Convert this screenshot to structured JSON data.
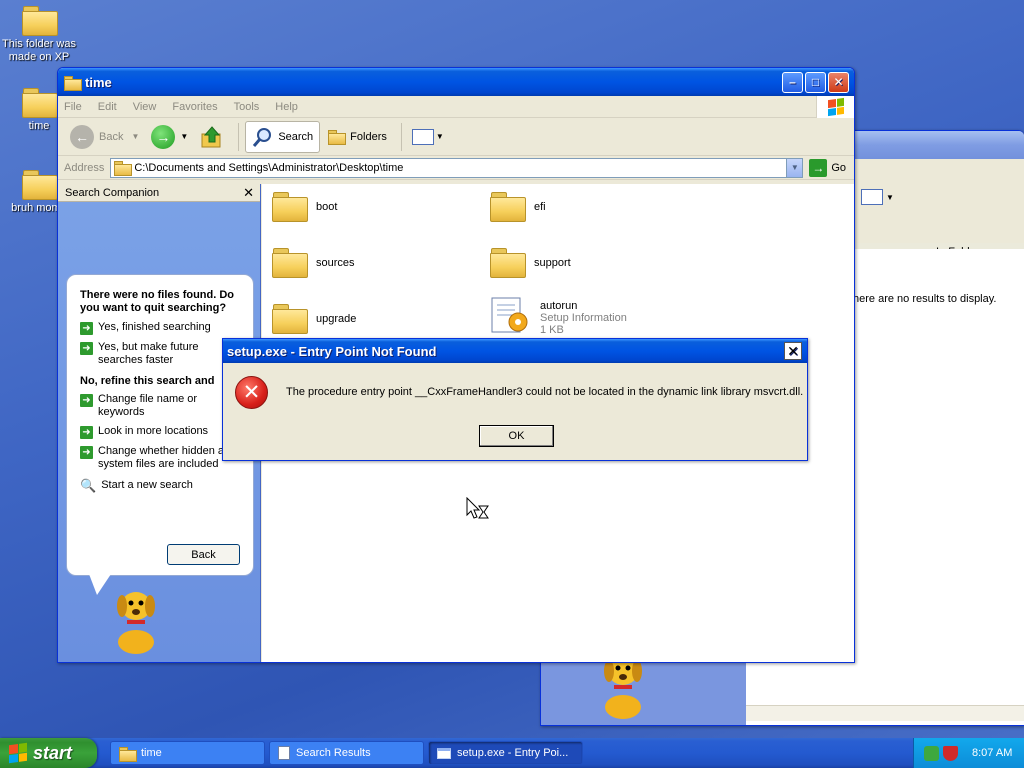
{
  "desktop": {
    "icons": [
      {
        "label": "This folder was made on XP"
      },
      {
        "label": "time"
      },
      {
        "label": "bruh mome"
      }
    ]
  },
  "background_window": {
    "column_header": "In Folder",
    "empty_message": "here are no results to display."
  },
  "explorer": {
    "title": "time",
    "menu": [
      "File",
      "Edit",
      "View",
      "Favorites",
      "Tools",
      "Help"
    ],
    "toolbar": {
      "back": "Back",
      "search": "Search",
      "folders": "Folders"
    },
    "address_label": "Address",
    "address_value": "C:\\Documents and Settings\\Administrator\\Desktop\\time",
    "go_label": "Go",
    "companion": {
      "header": "Search Companion",
      "heading": "There were no files found. Do you want to quit searching?",
      "options": [
        "Yes, finished searching",
        "Yes, but make future searches faster"
      ],
      "refine_heading": "No, refine this search and",
      "refine_options": [
        "Change file name or keywords",
        "Look in more locations",
        "Change whether hidden and system files are included"
      ],
      "new_search": "Start a new search",
      "back_button": "Back"
    },
    "files": [
      {
        "name": "boot"
      },
      {
        "name": "efi"
      },
      {
        "name": "sources"
      },
      {
        "name": "support"
      },
      {
        "name": "upgrade"
      },
      {
        "name": "autorun",
        "type": "Setup Information",
        "size": "1 KB"
      }
    ]
  },
  "dialog": {
    "title": "setup.exe - Entry Point Not Found",
    "message": "The procedure entry point __CxxFrameHandler3 could not be located in the dynamic link library msvcrt.dll.",
    "ok_label": "OK"
  },
  "taskbar": {
    "start_label": "start",
    "tasks": [
      "time",
      "Search Results",
      "setup.exe - Entry Poi..."
    ],
    "clock": "8:07 AM"
  },
  "colors": {
    "titlebar_blue": "#0054e3",
    "start_green": "#3aa23a",
    "error_red": "#d8201a"
  }
}
